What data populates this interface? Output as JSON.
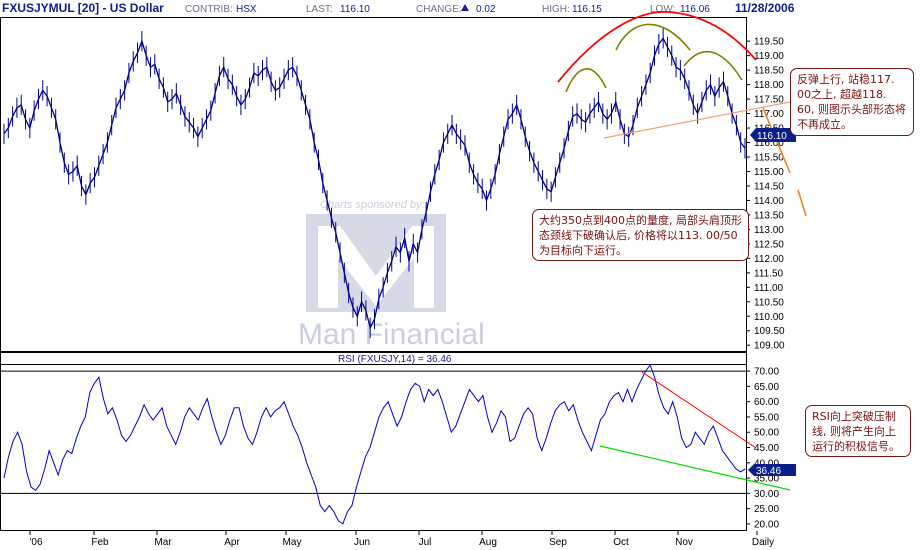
{
  "header": {
    "symbol": "FXUSJYMUL [20] - US Dollar",
    "contrib_label": "CONTRIB:",
    "contrib_value": "HSX",
    "last_label": "LAST:",
    "last_value": "116.10",
    "change_label": "CHANGE:",
    "change_value": "0.02",
    "high_label": "HIGH:",
    "high_value": "116.15",
    "low_label": "LOW:",
    "low_value": "116.06",
    "date": "11/28/2006"
  },
  "watermark": {
    "sponsor_text": "Charts sponsored by:",
    "logo_letter": "M",
    "brand_text": "Man Financial"
  },
  "annotations": {
    "right": "反弹上行, 站稳117. 00之上, 超越118. 60, 则图示头部形态将不再成立。",
    "middle": "大约350点到400点的量度, 局部头肩顶形态颈线下破确认后, 价格将以113. 00/50为目标向下运行。",
    "rsi": "RSI向上突破压制线, 则将产生向上运行的积极信号。"
  },
  "rsi_panel": {
    "title": "RSI (FXUSJY,14) = 36.46",
    "current_label": "36.46"
  },
  "colors": {
    "price_line": "#00008b",
    "rsi_line": "#0000cc",
    "head_arc": "#ff0000",
    "shoulder_arc": "#808000",
    "neckline": "#f0a070",
    "rsi_resistance": "#ff0000",
    "rsi_support": "#00dd00",
    "annotation_border": "#7a1515",
    "price_badge_bg": "#0b1f8a"
  },
  "chart_data": [
    {
      "type": "line",
      "title": "FXUSJYMUL [20] - US Dollar",
      "ylabel": "",
      "xlabel": "",
      "x_tick_labels": [
        "'06",
        "Feb",
        "Mar",
        "Apr",
        "May",
        "Jun",
        "Jul",
        "Aug",
        "Sep",
        "Oct",
        "Nov",
        "Daily"
      ],
      "y_tick_labels": [
        "119.50",
        "119.00",
        "118.50",
        "118.00",
        "117.50",
        "117.00",
        "116.50",
        "116.00",
        "115.50",
        "115.00",
        "114.50",
        "114.00",
        "113.50",
        "113.00",
        "112.50",
        "112.00",
        "111.50",
        "111.00",
        "110.50",
        "110.00",
        "109.50",
        "109.00"
      ],
      "ylim": [
        108.8,
        120.3
      ],
      "last_value_label": "116.10",
      "series": [
        {
          "values": [
            116.3,
            116.5,
            116.9,
            117.2,
            117.3,
            116.8,
            116.5,
            117.1,
            117.5,
            117.8,
            117.6,
            117.2,
            116.8,
            116.0,
            115.3,
            114.9,
            115.0,
            115.2,
            114.5,
            114.2,
            114.6,
            114.8,
            115.2,
            115.6,
            116.0,
            116.6,
            117.2,
            117.5,
            117.8,
            118.4,
            118.8,
            119.1,
            119.5,
            119.0,
            118.6,
            118.7,
            118.2,
            117.9,
            117.4,
            117.5,
            117.7,
            117.3,
            116.9,
            116.7,
            116.5,
            116.2,
            116.5,
            116.8,
            117.1,
            117.7,
            118.3,
            118.6,
            118.2,
            118.0,
            117.6,
            117.3,
            117.5,
            117.9,
            118.4,
            118.3,
            118.5,
            118.6,
            118.1,
            117.8,
            117.9,
            118.2,
            118.5,
            118.6,
            118.3,
            117.8,
            117.3,
            116.8,
            116.0,
            115.4,
            114.6,
            114.0,
            113.4,
            112.9,
            112.2,
            111.5,
            110.8,
            110.3,
            110.0,
            110.5,
            110.2,
            109.6,
            109.9,
            110.6,
            111.0,
            111.5,
            111.9,
            112.4,
            112.2,
            112.7,
            111.9,
            112.5,
            112.2,
            113.0,
            113.6,
            114.3,
            114.9,
            115.4,
            116.0,
            116.3,
            116.6,
            116.3,
            116.1,
            115.9,
            115.3,
            114.9,
            114.6,
            114.4,
            114.0,
            114.4,
            114.9,
            115.6,
            116.2,
            116.8,
            117.0,
            117.3,
            116.8,
            116.2,
            115.7,
            115.3,
            115.0,
            114.7,
            114.4,
            114.3,
            114.8,
            115.3,
            115.8,
            116.4,
            116.9,
            117.0,
            116.8,
            116.7,
            117.0,
            117.2,
            117.4,
            117.0,
            116.8,
            117.0,
            117.4,
            116.8,
            116.3,
            116.2,
            116.6,
            117.2,
            117.6,
            118.0,
            118.4,
            119.0,
            119.4,
            119.6,
            119.3,
            119.0,
            118.6,
            118.5,
            118.2,
            117.8,
            117.3,
            117.0,
            117.4,
            117.8,
            118.0,
            117.6,
            117.9,
            118.1,
            117.6,
            117.0,
            116.6,
            116.0,
            115.8
          ]
        }
      ]
    },
    {
      "type": "line",
      "title": "RSI (FXUSJY,14) = 36.46",
      "ylabel": "",
      "xlabel": "",
      "y_tick_labels": [
        "70.00",
        "65.00",
        "60.00",
        "55.00",
        "50.00",
        "45.00",
        "40.00",
        "35.00",
        "30.00",
        "25.00",
        "20.00"
      ],
      "ylim": [
        18,
        72
      ],
      "reference_lines": [
        70,
        30
      ],
      "last_value_label": "36.46",
      "series": [
        {
          "values": [
            35,
            42,
            47,
            50,
            46,
            37,
            32,
            31,
            33,
            38,
            44,
            40,
            36,
            41,
            44,
            43,
            48,
            52,
            55,
            63,
            66,
            68,
            61,
            56,
            58,
            54,
            49,
            47,
            49,
            52,
            55,
            59,
            56,
            54,
            56,
            58,
            52,
            49,
            46,
            50,
            55,
            58,
            56,
            54,
            58,
            61,
            55,
            50,
            46,
            49,
            54,
            58,
            58,
            52,
            48,
            46,
            50,
            55,
            58,
            55,
            57,
            58,
            60,
            56,
            52,
            49,
            45,
            40,
            36,
            32,
            26,
            24,
            26,
            24,
            21,
            20,
            24,
            26,
            32,
            37,
            42,
            45,
            50,
            55,
            58,
            60,
            56,
            52,
            55,
            60,
            64,
            66,
            65,
            60,
            64,
            62,
            64,
            60,
            55,
            50,
            52,
            56,
            60,
            64,
            62,
            60,
            62,
            55,
            50,
            53,
            57,
            55,
            47,
            48,
            52,
            56,
            58,
            56,
            48,
            44,
            48,
            53,
            57,
            59,
            60,
            57,
            59,
            54,
            50,
            47,
            44,
            49,
            54,
            56,
            60,
            62,
            63,
            60,
            64,
            60,
            64,
            67,
            70,
            72,
            68,
            62,
            58,
            56,
            60,
            55,
            48,
            45,
            46,
            50,
            48,
            46,
            50,
            52,
            48,
            44,
            42,
            40,
            38,
            37,
            38
          ]
        }
      ]
    }
  ]
}
